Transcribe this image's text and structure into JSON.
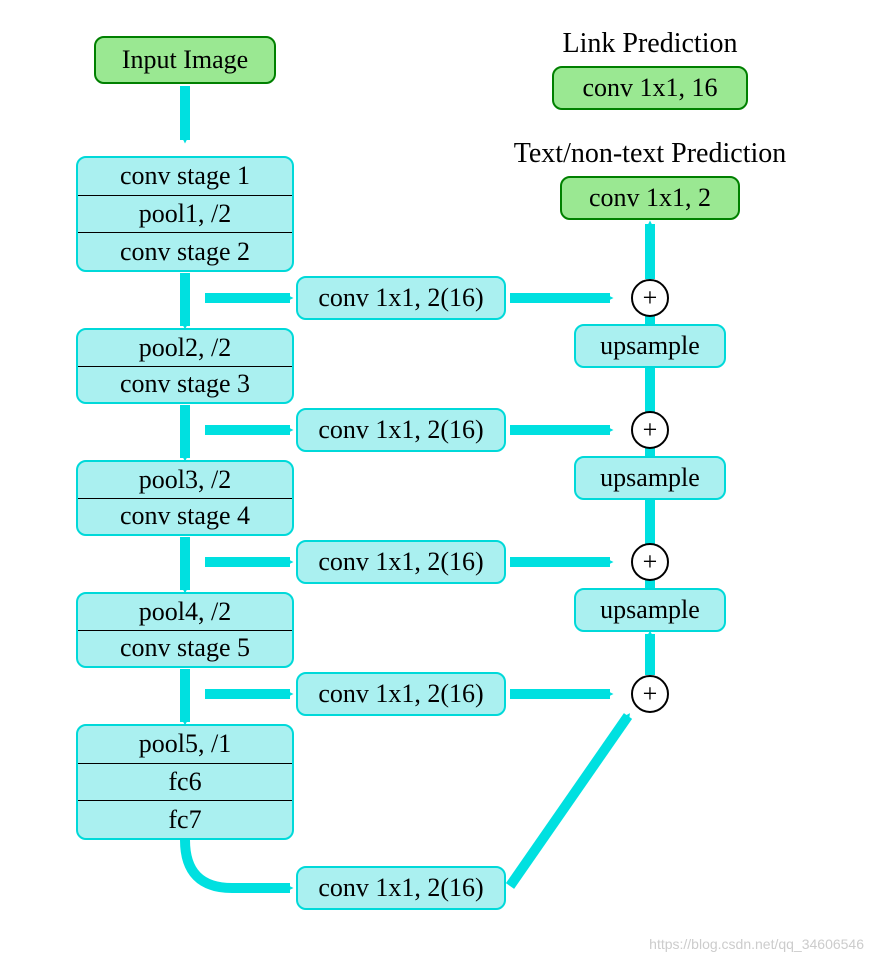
{
  "input": {
    "label": "Input Image"
  },
  "stage1": {
    "rows": [
      "conv stage 1",
      "pool1, /2",
      "conv stage 2"
    ]
  },
  "stage2": {
    "rows": [
      "pool2, /2",
      "conv stage 3"
    ]
  },
  "stage3": {
    "rows": [
      "pool3, /2",
      "conv stage 4"
    ]
  },
  "stage4": {
    "rows": [
      "pool4, /2",
      "conv stage 5"
    ]
  },
  "stage5": {
    "rows": [
      "pool5, /1",
      "fc6",
      "fc7"
    ]
  },
  "lateral": {
    "l1": "conv 1x1, 2(16)",
    "l2": "conv 1x1, 2(16)",
    "l3": "conv 1x1, 2(16)",
    "l4": "conv 1x1, 2(16)",
    "l5": "conv 1x1, 2(16)"
  },
  "upsample": {
    "u1": "upsample",
    "u2": "upsample",
    "u3": "upsample"
  },
  "plus": {
    "p1": "+",
    "p2": "+",
    "p3": "+",
    "p4": "+"
  },
  "outputs": {
    "link_label": "Link Prediction",
    "link_box": "conv 1x1, 16",
    "text_label": "Text/non-text Prediction",
    "text_box": "conv 1x1, 2"
  },
  "watermark": "https://blog.csdn.net/qq_34606546"
}
